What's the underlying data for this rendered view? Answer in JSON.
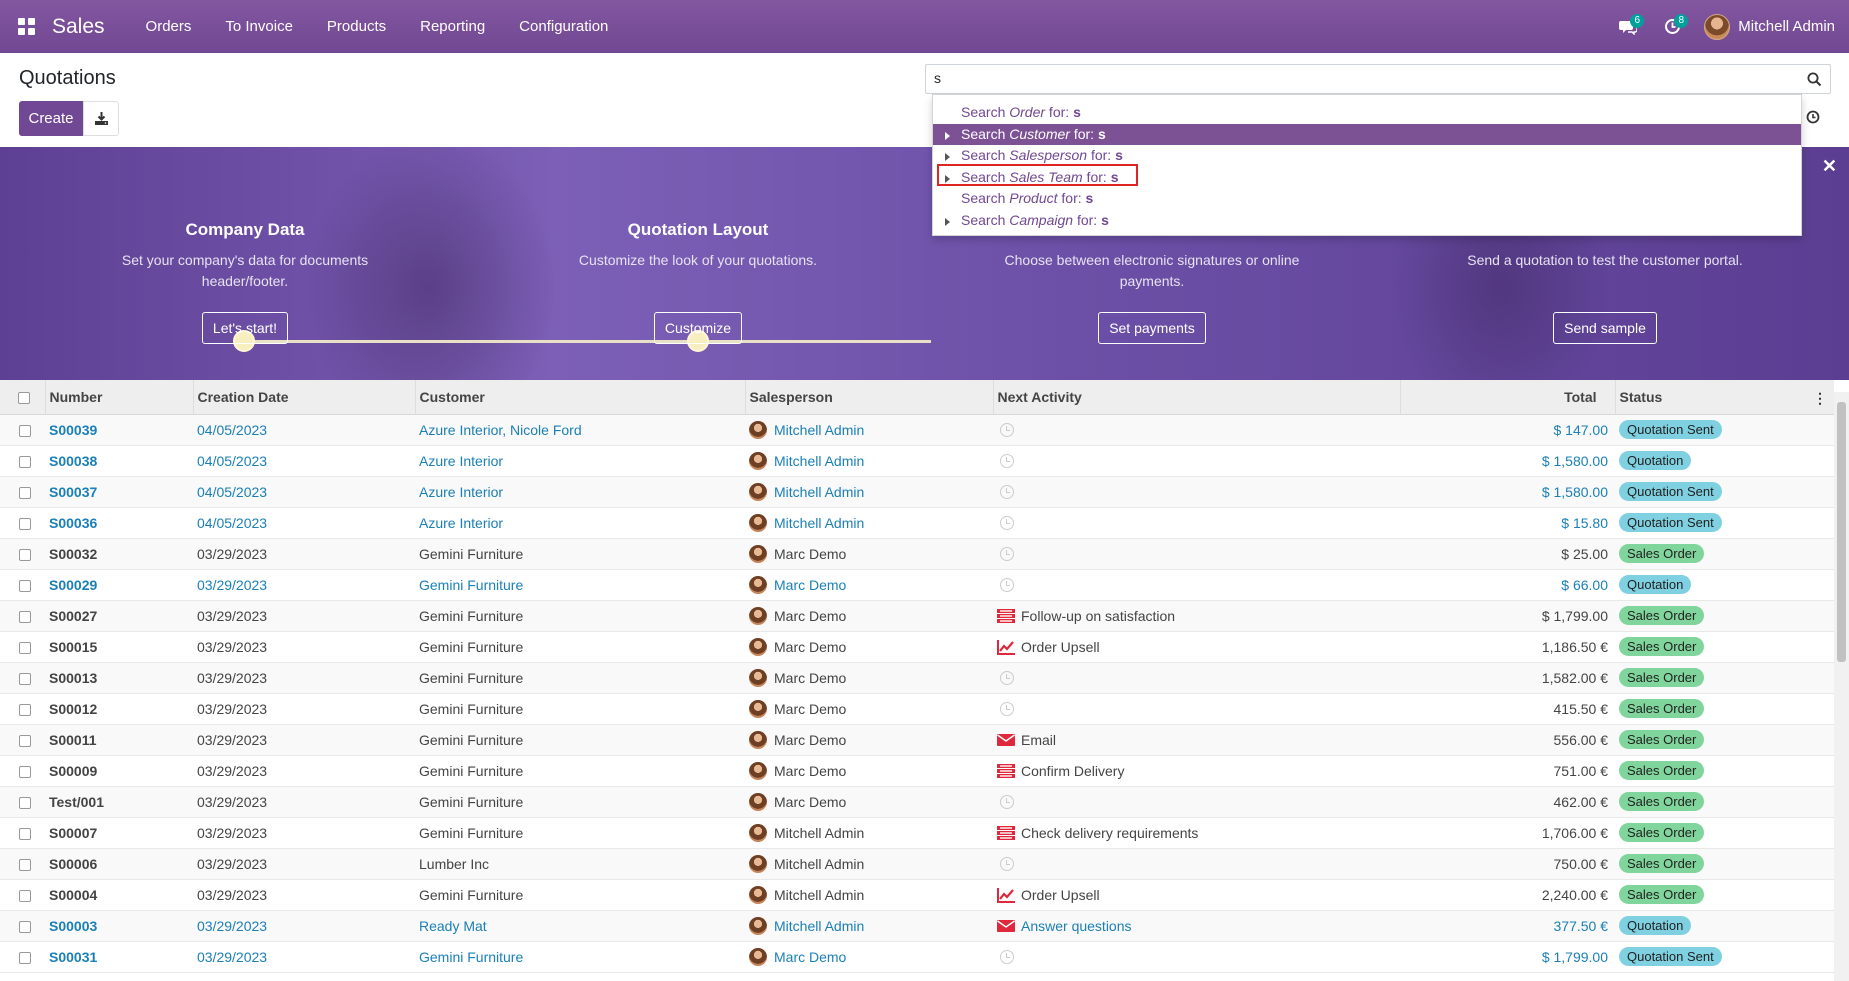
{
  "navbar": {
    "app_name": "Sales",
    "menu": [
      "Orders",
      "To Invoice",
      "Products",
      "Reporting",
      "Configuration"
    ],
    "messages_count": "6",
    "activities_count": "8",
    "user_name": "Mitchell Admin"
  },
  "control_panel": {
    "title": "Quotations",
    "create_label": "Create",
    "search_value": "s"
  },
  "autocomplete": [
    {
      "prefix": "Search ",
      "field": "Order",
      "suffix": " for: ",
      "term": "s",
      "expandable": false,
      "active": false
    },
    {
      "prefix": "Search ",
      "field": "Customer",
      "suffix": " for: ",
      "term": "s",
      "expandable": true,
      "active": true
    },
    {
      "prefix": "Search ",
      "field": "Salesperson",
      "suffix": " for: ",
      "term": "s",
      "expandable": true,
      "active": false
    },
    {
      "prefix": "Search ",
      "field": "Sales Team",
      "suffix": " for: ",
      "term": "s",
      "expandable": true,
      "active": false
    },
    {
      "prefix": "Search ",
      "field": "Product",
      "suffix": " for: ",
      "term": "s",
      "expandable": false,
      "active": false
    },
    {
      "prefix": "Search ",
      "field": "Campaign",
      "suffix": " for: ",
      "term": "s",
      "expandable": true,
      "active": false
    }
  ],
  "onboarding": {
    "steps": [
      {
        "title": "Company Data",
        "desc": "Set your company's data for documents header/footer.",
        "button": "Let's start!"
      },
      {
        "title": "Quotation Layout",
        "desc": "Customize the look of your quotations.",
        "button": "Customize"
      },
      {
        "title": "",
        "desc": "Choose between electronic signatures or online payments.",
        "button": "Set payments"
      },
      {
        "title": "",
        "desc": "Send a quotation to test the customer portal.",
        "button": "Send sample"
      }
    ]
  },
  "table": {
    "columns": {
      "number": "Number",
      "creation_date": "Creation Date",
      "customer": "Customer",
      "salesperson": "Salesperson",
      "next_activity": "Next Activity",
      "total": "Total",
      "status": "Status"
    },
    "rows": [
      {
        "number": "S00039",
        "date": "04/05/2023",
        "customer": "Azure Interior, Nicole Ford",
        "salesperson": "Mitchell Admin",
        "activity": "",
        "activity_icon": "clock-icon",
        "total": "$ 147.00",
        "status": "Quotation Sent",
        "status_kind": "sent",
        "linked": true
      },
      {
        "number": "S00038",
        "date": "04/05/2023",
        "customer": "Azure Interior",
        "salesperson": "Mitchell Admin",
        "activity": "",
        "activity_icon": "clock-icon",
        "total": "$ 1,580.00",
        "status": "Quotation",
        "status_kind": "quotation",
        "linked": true
      },
      {
        "number": "S00037",
        "date": "04/05/2023",
        "customer": "Azure Interior",
        "salesperson": "Mitchell Admin",
        "activity": "",
        "activity_icon": "clock-icon",
        "total": "$ 1,580.00",
        "status": "Quotation Sent",
        "status_kind": "sent",
        "linked": true
      },
      {
        "number": "S00036",
        "date": "04/05/2023",
        "customer": "Azure Interior",
        "salesperson": "Mitchell Admin",
        "activity": "",
        "activity_icon": "clock-icon",
        "total": "$ 15.80",
        "status": "Quotation Sent",
        "status_kind": "sent",
        "linked": true
      },
      {
        "number": "S00032",
        "date": "03/29/2023",
        "customer": "Gemini Furniture",
        "salesperson": "Marc Demo",
        "activity": "",
        "activity_icon": "clock-icon",
        "total": "$ 25.00",
        "status": "Sales Order",
        "status_kind": "sales",
        "linked": false
      },
      {
        "number": "S00029",
        "date": "03/29/2023",
        "customer": "Gemini Furniture",
        "salesperson": "Marc Demo",
        "activity": "",
        "activity_icon": "clock-icon",
        "total": "$ 66.00",
        "status": "Quotation",
        "status_kind": "quotation",
        "linked": true
      },
      {
        "number": "S00027",
        "date": "03/29/2023",
        "customer": "Gemini Furniture",
        "salesperson": "Marc Demo",
        "activity": "Follow-up on satisfaction",
        "activity_icon": "tasks-icon",
        "total": "$ 1,799.00",
        "status": "Sales Order",
        "status_kind": "sales",
        "linked": false
      },
      {
        "number": "S00015",
        "date": "03/29/2023",
        "customer": "Gemini Furniture",
        "salesperson": "Marc Demo",
        "activity": "Order Upsell",
        "activity_icon": "chart-icon",
        "total": "1,186.50 €",
        "status": "Sales Order",
        "status_kind": "sales",
        "linked": false
      },
      {
        "number": "S00013",
        "date": "03/29/2023",
        "customer": "Gemini Furniture",
        "salesperson": "Marc Demo",
        "activity": "",
        "activity_icon": "clock-icon",
        "total": "1,582.00 €",
        "status": "Sales Order",
        "status_kind": "sales",
        "linked": false
      },
      {
        "number": "S00012",
        "date": "03/29/2023",
        "customer": "Gemini Furniture",
        "salesperson": "Marc Demo",
        "activity": "",
        "activity_icon": "clock-icon",
        "total": "415.50 €",
        "status": "Sales Order",
        "status_kind": "sales",
        "linked": false
      },
      {
        "number": "S00011",
        "date": "03/29/2023",
        "customer": "Gemini Furniture",
        "salesperson": "Marc Demo",
        "activity": "Email",
        "activity_icon": "envelope-icon",
        "total": "556.00 €",
        "status": "Sales Order",
        "status_kind": "sales",
        "linked": false
      },
      {
        "number": "S00009",
        "date": "03/29/2023",
        "customer": "Gemini Furniture",
        "salesperson": "Marc Demo",
        "activity": "Confirm Delivery",
        "activity_icon": "tasks-icon",
        "total": "751.00 €",
        "status": "Sales Order",
        "status_kind": "sales",
        "linked": false
      },
      {
        "number": "Test/001",
        "date": "03/29/2023",
        "customer": "Gemini Furniture",
        "salesperson": "Marc Demo",
        "activity": "",
        "activity_icon": "clock-icon",
        "total": "462.00 €",
        "status": "Sales Order",
        "status_kind": "sales",
        "linked": false
      },
      {
        "number": "S00007",
        "date": "03/29/2023",
        "customer": "Gemini Furniture",
        "salesperson": "Mitchell Admin",
        "activity": "Check delivery requirements",
        "activity_icon": "tasks-icon",
        "total": "1,706.00 €",
        "status": "Sales Order",
        "status_kind": "sales",
        "linked": false
      },
      {
        "number": "S00006",
        "date": "03/29/2023",
        "customer": "Lumber Inc",
        "salesperson": "Mitchell Admin",
        "activity": "",
        "activity_icon": "clock-icon",
        "total": "750.00 €",
        "status": "Sales Order",
        "status_kind": "sales",
        "linked": false
      },
      {
        "number": "S00004",
        "date": "03/29/2023",
        "customer": "Gemini Furniture",
        "salesperson": "Mitchell Admin",
        "activity": "Order Upsell",
        "activity_icon": "chart-icon",
        "total": "2,240.00 €",
        "status": "Sales Order",
        "status_kind": "sales",
        "linked": false
      },
      {
        "number": "S00003",
        "date": "03/29/2023",
        "customer": "Ready Mat",
        "salesperson": "Mitchell Admin",
        "activity": "Answer questions",
        "activity_icon": "envelope-icon",
        "total": "377.50 €",
        "status": "Quotation",
        "status_kind": "quotation",
        "linked": true
      },
      {
        "number": "S00031",
        "date": "03/29/2023",
        "customer": "Gemini Furniture",
        "salesperson": "Marc Demo",
        "activity": "",
        "activity_icon": "clock-icon",
        "total": "$ 1,799.00",
        "status": "Quotation Sent",
        "status_kind": "sent",
        "linked": true
      }
    ]
  },
  "colors": {
    "brand": "#714893",
    "link": "#1b80b7",
    "badge_sent": "#7fd1e1",
    "badge_sales": "#7fd59b",
    "activity_icon": "#e0283c"
  }
}
